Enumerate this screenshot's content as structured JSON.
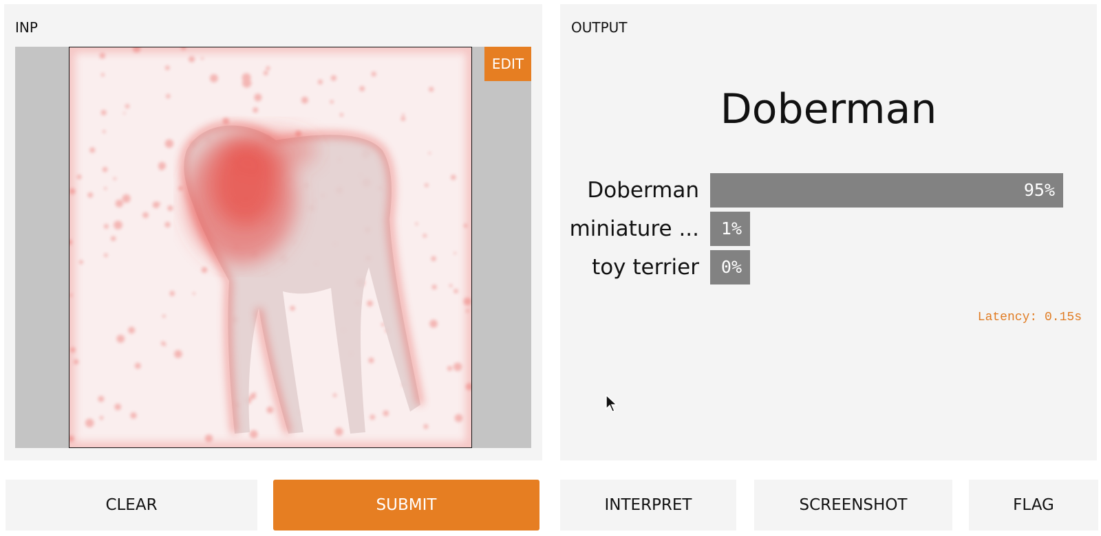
{
  "input": {
    "label": "INP",
    "edit_label": "EDIT"
  },
  "output": {
    "label": "OUTPUT",
    "top_label": "Doberman",
    "confidences": [
      {
        "name": "Doberman",
        "value_text": "95%",
        "value": 0.95
      },
      {
        "name": "miniature ...",
        "value_text": "1%",
        "value": 0.01
      },
      {
        "name": "toy terrier",
        "value_text": "0%",
        "value": 0.0
      }
    ],
    "latency": "Latency: 0.15s"
  },
  "buttons": {
    "clear": "CLEAR",
    "submit": "SUBMIT",
    "interpret": "INTERPRET",
    "screenshot": "SCREENSHOT",
    "flag": "FLAG"
  },
  "colors": {
    "accent": "#e67e22",
    "bar": "#828282",
    "panel": "#f4f4f4",
    "latency": "#e07b22",
    "heat": "#e8504a"
  },
  "icons": {
    "cursor": "mouse-pointer-icon"
  }
}
